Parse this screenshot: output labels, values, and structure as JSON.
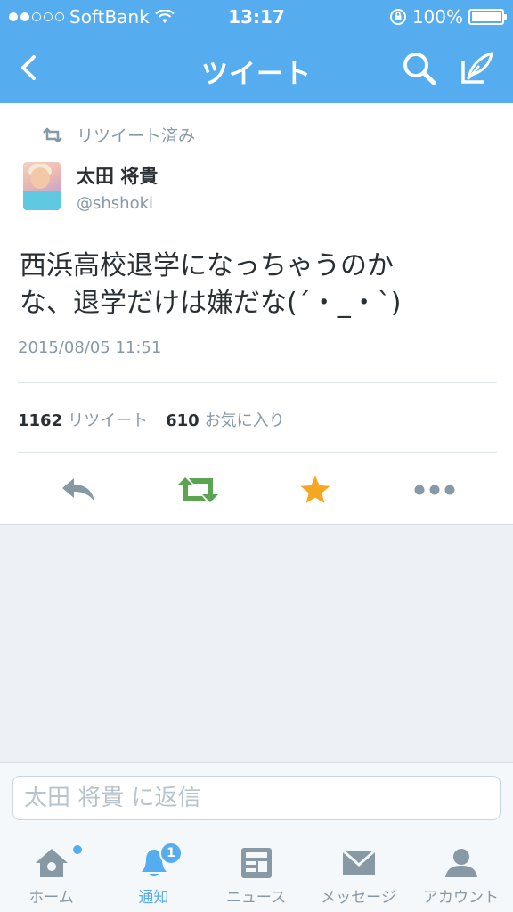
{
  "status_bar": {
    "carrier": "SoftBank",
    "time": "13:17",
    "battery": "100%",
    "signal_bars": 2
  },
  "header": {
    "title": "ツイート",
    "back_icon": "chevron-left-icon",
    "search_icon": "search-icon",
    "compose_icon": "compose-icon"
  },
  "tweet": {
    "retweeted_label": "リツイート済み",
    "author_name": "太田 将貴",
    "author_handle": "@shshoki",
    "text": "西浜高校退学になっちゃうのか\nな、退学だけは嫌だな(´・_・`)",
    "date": "2015/08/05 11:51",
    "retweet_count": "1162",
    "retweet_label": "リツイート",
    "favorite_count": "610",
    "favorite_label": "お気に入り"
  },
  "actions": {
    "reply_icon": "reply-icon",
    "retweet_icon": "retweet-icon",
    "favorite_icon": "star-icon",
    "more_icon": "more-icon"
  },
  "reply": {
    "placeholder": "太田 将貴 に返信"
  },
  "tabbar": {
    "items": [
      {
        "label": "ホーム",
        "icon": "home-icon"
      },
      {
        "label": "通知",
        "icon": "bell-icon",
        "badge": "1"
      },
      {
        "label": "ニュース",
        "icon": "news-icon"
      },
      {
        "label": "メッセージ",
        "icon": "envelope-icon"
      },
      {
        "label": "アカウント",
        "icon": "person-icon"
      }
    ],
    "active_index": 1
  },
  "colors": {
    "brand_blue": "#55acee",
    "retweet_green": "#5ba451",
    "favorite_gold": "#f5a623",
    "muted_gray": "#8899a6"
  }
}
